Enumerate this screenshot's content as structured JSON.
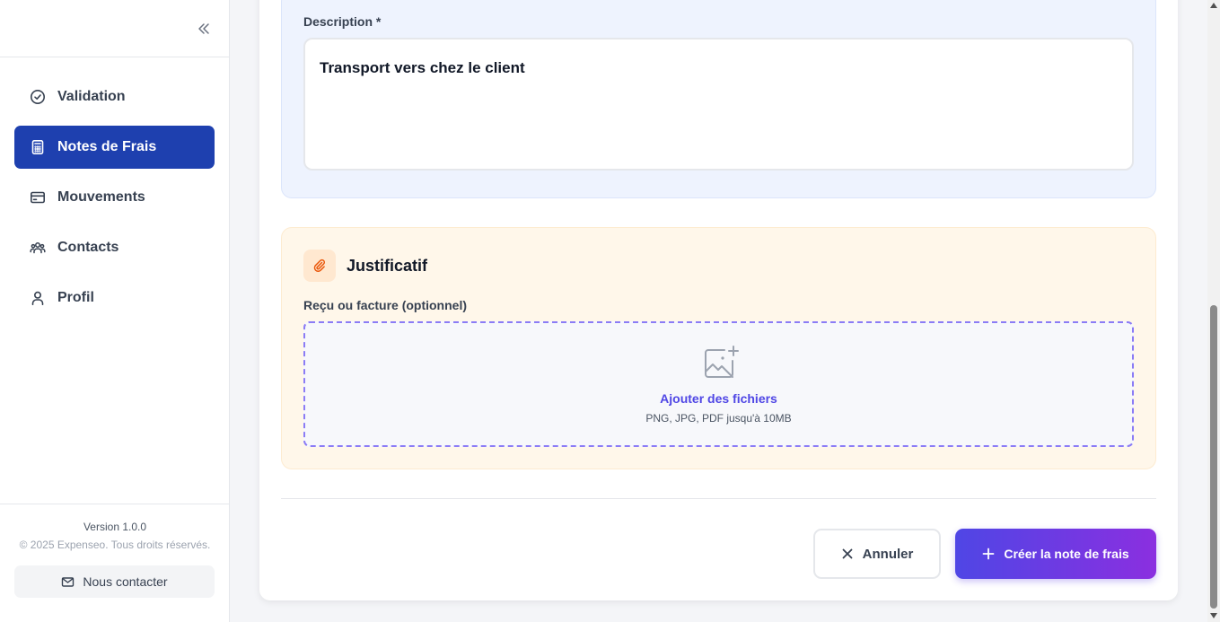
{
  "sidebar": {
    "items": [
      {
        "label": "Validation",
        "icon": "check-circle-icon",
        "active": false
      },
      {
        "label": "Notes de Frais",
        "icon": "calculator-icon",
        "active": true
      },
      {
        "label": "Mouvements",
        "icon": "card-icon",
        "active": false
      },
      {
        "label": "Contacts",
        "icon": "users-icon",
        "active": false
      },
      {
        "label": "Profil",
        "icon": "user-icon",
        "active": false
      }
    ],
    "version": "Version 1.0.0",
    "copyright": "© 2025 Expenseo. Tous droits réservés.",
    "contact_label": "Nous contacter"
  },
  "form": {
    "description_label": "Description *",
    "description_value": "Transport vers chez le client",
    "justificatif_title": "Justificatif",
    "receipt_label": "Reçu ou facture (optionnel)",
    "dropzone_cta": "Ajouter des fichiers",
    "dropzone_hint": "PNG, JPG, PDF jusqu'à 10MB"
  },
  "actions": {
    "cancel_label": "Annuler",
    "create_label": "Créer la note de frais"
  },
  "colors": {
    "active_nav": "#1e40af",
    "primary_gradient_start": "#4f46e5",
    "primary_gradient_end": "#8b2fe0",
    "description_bg": "#eef3fe",
    "justificatif_bg": "#fff7ea",
    "dropzone_border": "#8b7cf6"
  }
}
